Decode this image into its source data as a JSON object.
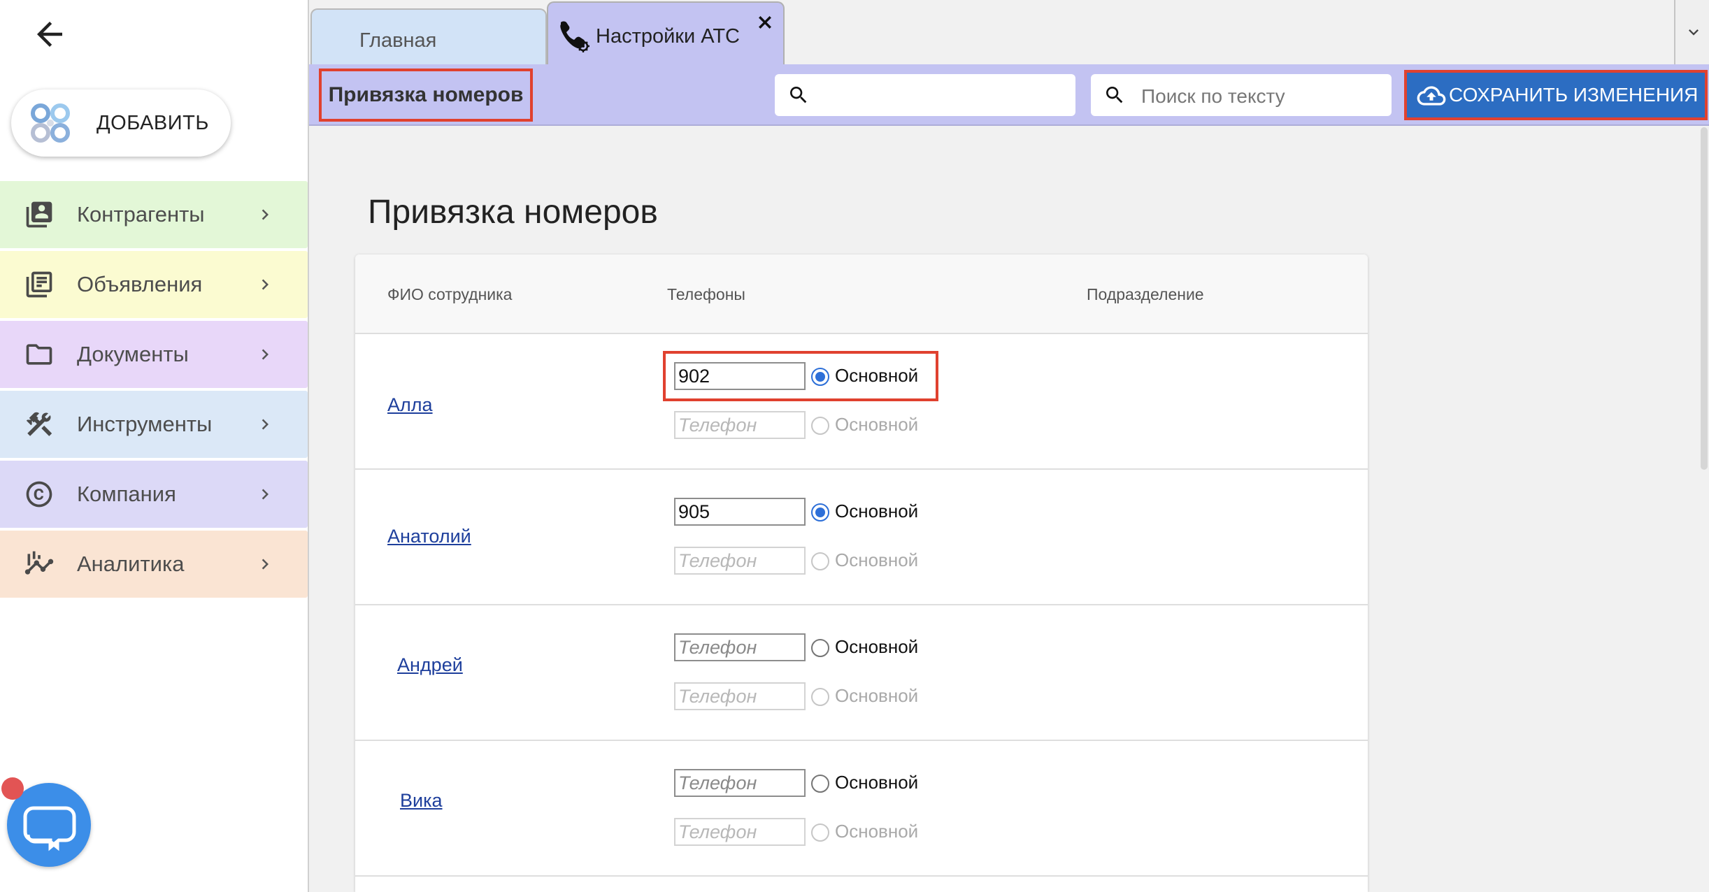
{
  "sidebar": {
    "add_label": "ДОБАВИТЬ",
    "items": [
      {
        "label": "Контрагенты",
        "icon": "contacts-icon",
        "color": "#e3f7d7"
      },
      {
        "label": "Объявления",
        "icon": "announcements-icon",
        "color": "#fbfbd1"
      },
      {
        "label": "Документы",
        "icon": "folder-icon",
        "color": "#e8d7f9"
      },
      {
        "label": "Инструменты",
        "icon": "tools-icon",
        "color": "#dbe8f7"
      },
      {
        "label": "Компания",
        "icon": "copyright-icon",
        "color": "#dcd9f7"
      },
      {
        "label": "Аналитика",
        "icon": "analytics-icon",
        "color": "#fae4d3"
      }
    ]
  },
  "tabs": [
    {
      "label": "Главная",
      "active": false
    },
    {
      "label": "Настройки АТС",
      "active": true
    }
  ],
  "toolbar": {
    "section_title": "Привязка номеров",
    "search1_placeholder": "",
    "search2_placeholder": "Поиск по тексту",
    "save_label": "СОХРАНИТЬ ИЗМЕНЕНИЯ"
  },
  "page": {
    "title": "Привязка номеров"
  },
  "table": {
    "headers": {
      "name": "ФИО сотрудника",
      "phones": "Телефоны",
      "dept": "Подразделение"
    },
    "phone_placeholder": "Телефон",
    "radio_label": "Основной",
    "rows": [
      {
        "name": "Алла",
        "phone1": "902",
        "primary": true
      },
      {
        "name": "Анатолий",
        "phone1": "905",
        "primary": true
      },
      {
        "name": "Андрей",
        "phone1": "",
        "primary": false
      },
      {
        "name": "Вика",
        "phone1": "",
        "primary": false
      }
    ]
  },
  "colors": {
    "accent_tab": "#c3c3f2",
    "save_button": "#2c6dc2",
    "highlight": "#e0412f",
    "link": "#1e3f9c"
  }
}
